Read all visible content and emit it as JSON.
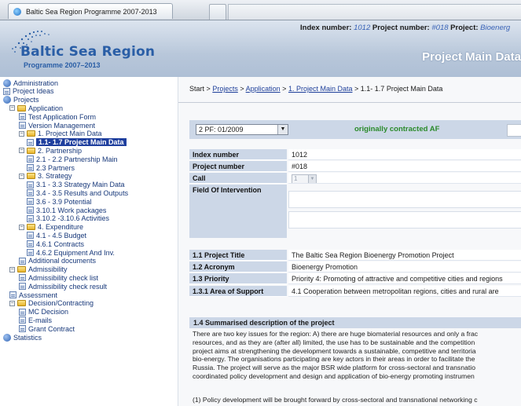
{
  "browser": {
    "tab_title": "Baltic Sea Region Programme 2007-2013"
  },
  "header": {
    "logo_title": "Baltic Sea Region",
    "logo_subtitle": "Programme 2007–2013",
    "index_label": "Index number:",
    "index_value": "1012",
    "project_number_label": "Project number:",
    "project_number_value": "#018",
    "project_label": "Project:",
    "project_value": "Bioenerg",
    "page_heading": "Project Main Data"
  },
  "sidebar": {
    "items": [
      {
        "label": "Administration",
        "icon": "root-icon"
      },
      {
        "label": "Project Ideas",
        "icon": "page-icon"
      },
      {
        "label": "Projects",
        "icon": "root-icon"
      },
      {
        "label": "Application",
        "icon": "folder-icon",
        "toggle": "−"
      },
      {
        "label": "Test Application Form",
        "icon": "page-icon"
      },
      {
        "label": "Version Management",
        "icon": "page-icon"
      },
      {
        "label": "1. Project Main Data",
        "icon": "folder-icon",
        "toggle": "−"
      },
      {
        "label": "1.1- 1.7 Project Main Data",
        "icon": "page-icon",
        "selected": true
      },
      {
        "label": "2. Partnership",
        "icon": "folder-icon",
        "toggle": "−"
      },
      {
        "label": "2.1 - 2.2 Partnership Main",
        "icon": "page-icon"
      },
      {
        "label": "2.3 Partners",
        "icon": "page-icon"
      },
      {
        "label": "3. Strategy",
        "icon": "folder-icon",
        "toggle": "−"
      },
      {
        "label": "3.1 - 3.3 Strategy Main Data",
        "icon": "page-icon"
      },
      {
        "label": "3.4 - 3.5 Results and Outputs",
        "icon": "page-icon"
      },
      {
        "label": "3.6 - 3.9 Potential",
        "icon": "page-icon"
      },
      {
        "label": "3.10.1 Work packages",
        "icon": "page-icon"
      },
      {
        "label": "3.10.2 -3.10.6 Activities",
        "icon": "page-icon"
      },
      {
        "label": "4. Expenditure",
        "icon": "folder-icon",
        "toggle": "−"
      },
      {
        "label": "4.1 - 4.5 Budget",
        "icon": "page-icon"
      },
      {
        "label": "4.6.1 Contracts",
        "icon": "page-icon"
      },
      {
        "label": "4.6.2 Equipment And Inv.",
        "icon": "page-icon"
      },
      {
        "label": "Additional documents",
        "icon": "page-icon"
      },
      {
        "label": "Admissibility",
        "icon": "folder-icon",
        "toggle": "−"
      },
      {
        "label": "Admissibility check list",
        "icon": "page-icon"
      },
      {
        "label": "Admissibility check result",
        "icon": "page-icon"
      },
      {
        "label": "Assessment",
        "icon": "page-icon"
      },
      {
        "label": "Decision/Contracting",
        "icon": "folder-icon",
        "toggle": "−"
      },
      {
        "label": "MC Decision",
        "icon": "page-icon"
      },
      {
        "label": "E-mails",
        "icon": "page-icon"
      },
      {
        "label": "Grant Contract",
        "icon": "page-icon"
      },
      {
        "label": "Statistics",
        "icon": "root-icon"
      }
    ]
  },
  "breadcrumb": {
    "start": "Start",
    "sep": ">",
    "projects": "Projects",
    "application": "Application",
    "main_data": "1. Project Main Data",
    "current": "1.1- 1.7 Project Main Data"
  },
  "version": {
    "selected": "2 PF: 01/2009",
    "status": "originally contracted AF"
  },
  "form": {
    "index_number_label": "Index number",
    "index_number_value": "1012",
    "project_number_label": "Project number",
    "project_number_value": "#018",
    "call_label": "Call",
    "call_value": "1",
    "field_of_intervention_label": "Field Of Intervention",
    "title_label": "1.1 Project Title",
    "title_value": "The Baltic Sea Region Bioenergy Promotion Project",
    "acronym_label": "1.2 Acronym",
    "acronym_value": "Bioenergy Promotion",
    "priority_label": "1.3 Priority",
    "priority_value": "Priority 4: Promoting of attractive and competitive cities and regions",
    "area_label": "1.3.1 Area of Support",
    "area_value": "4.1 Cooperation between metropolitan regions, cities and rural are"
  },
  "summary": {
    "heading": "1.4 Summarised description of the project",
    "lines": [
      "There are two key issues for the region: A) there are huge biomaterial resources and only a frac",
      "resources, and as they are (after all) limited, the use has to be sustainable and the competition",
      "project aims at strengthening the development towards a sustainable, competitive and territoria",
      "bio-energy. The organisations participating are key actors in their areas in order to facilitate the",
      "Russia. The project will serve as the major BSR wide platform for cross-sectoral and transnatio",
      "coordinated policy development and design and application of bio-energy promoting instrumen"
    ],
    "continuation": "(1) Policy development will be brought forward by cross-sectoral and transnational networking c"
  },
  "colors": {
    "header_bg": "#b8c7da",
    "label_bg": "#ccd7e7",
    "selected_bg": "#1f3f9e",
    "link": "#1e3f9a",
    "status_green": "#2a8a2a"
  }
}
